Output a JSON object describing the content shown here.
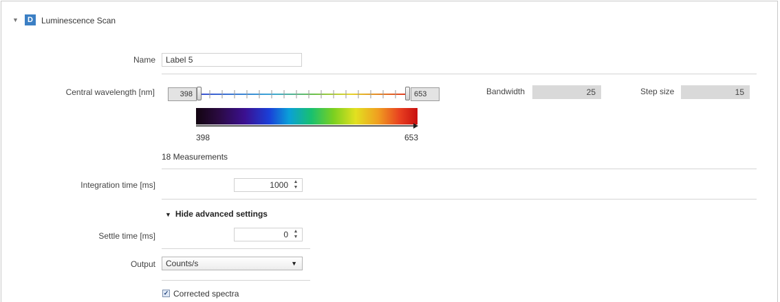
{
  "panel": {
    "badge": "D",
    "title": "Luminescence Scan"
  },
  "name": {
    "label": "Name",
    "value": "Label 5"
  },
  "wavelength": {
    "label": "Central wavelength [nm]",
    "min": "398",
    "max": "653",
    "spectrum_start": "398",
    "spectrum_end": "653",
    "measurements": "18 Measurements"
  },
  "bandwidth": {
    "label": "Bandwidth",
    "value": "25"
  },
  "step": {
    "label": "Step size",
    "value": "15"
  },
  "integration": {
    "label": "Integration time [ms]",
    "value": "1000"
  },
  "advanced": {
    "toggle_label": "Hide advanced settings"
  },
  "settle": {
    "label": "Settle time [ms]",
    "value": "0"
  },
  "output": {
    "label": "Output",
    "selected": "Counts/s"
  },
  "corrected": {
    "label": "Corrected spectra",
    "checked": true
  },
  "icons": {
    "collapse": "triangle-down-icon",
    "spin": "spin-arrows-icon",
    "dropdown": "dropdown-arrow-icon",
    "check": "checkmark-icon"
  },
  "colors": {
    "badge": "#3b7fc4",
    "field_gray": "#d9d9d9"
  }
}
